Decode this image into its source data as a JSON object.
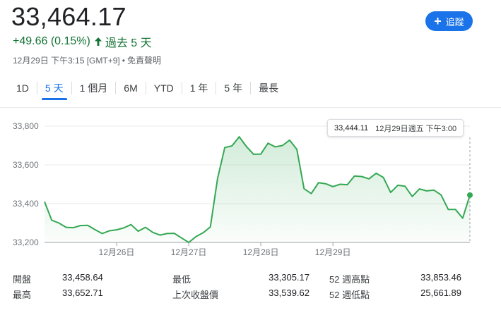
{
  "header": {
    "price": "33,464.17",
    "change": "+49.66 (0.15%)",
    "period": "過去 5 天",
    "timestamp": "12月29日 下午3:15 [GMT+9]",
    "disclaimer": "免責聲明",
    "follow_label": "追蹤"
  },
  "tabs": [
    {
      "label": "1D",
      "active": false
    },
    {
      "label": "5 天",
      "active": true
    },
    {
      "label": "1 個月",
      "active": false
    },
    {
      "label": "6M",
      "active": false
    },
    {
      "label": "YTD",
      "active": false
    },
    {
      "label": "1 年",
      "active": false
    },
    {
      "label": "5 年",
      "active": false
    },
    {
      "label": "最長",
      "active": false
    }
  ],
  "tooltip": {
    "value": "33,444.11",
    "time": "12月29日週五 下午3:00"
  },
  "colors": {
    "line": "#34a853",
    "accent": "#1a73e8",
    "up": "#137333"
  },
  "chart_data": {
    "type": "area",
    "y_ticks": [
      "33,800",
      "33,600",
      "33,400",
      "33,200"
    ],
    "y_tick_values": [
      33800,
      33600,
      33400,
      33200
    ],
    "ylim": [
      33200,
      33850
    ],
    "x_ticks": [
      {
        "label": "12月26日",
        "index": 10
      },
      {
        "label": "12月27日",
        "index": 20
      },
      {
        "label": "12月28日",
        "index": 30
      },
      {
        "label": "12月29日",
        "index": 40
      }
    ],
    "values": [
      33410,
      33315,
      33300,
      33278,
      33276,
      33287,
      33288,
      33266,
      33246,
      33260,
      33265,
      33275,
      33292,
      33258,
      33278,
      33252,
      33238,
      33246,
      33247,
      33223,
      33200,
      33230,
      33250,
      33280,
      33530,
      33690,
      33698,
      33745,
      33695,
      33655,
      33656,
      33712,
      33693,
      33700,
      33728,
      33680,
      33477,
      33452,
      33508,
      33503,
      33488,
      33500,
      33498,
      33543,
      33540,
      33528,
      33557,
      33535,
      33458,
      33495,
      33490,
      33437,
      33476,
      33466,
      33470,
      33445,
      33370,
      33370,
      33325,
      33444
    ],
    "last_value": 33444.11
  },
  "stats": [
    [
      {
        "label": "開盤",
        "value": "33,458.64"
      },
      {
        "label": "最低",
        "value": "33,305.17"
      },
      {
        "label": "52 週高點",
        "value": "33,853.46"
      }
    ],
    [
      {
        "label": "最高",
        "value": "33,652.71"
      },
      {
        "label": "上次收盤價",
        "value": "33,539.62"
      },
      {
        "label": "52 週低點",
        "value": "25,661.89"
      }
    ]
  ]
}
